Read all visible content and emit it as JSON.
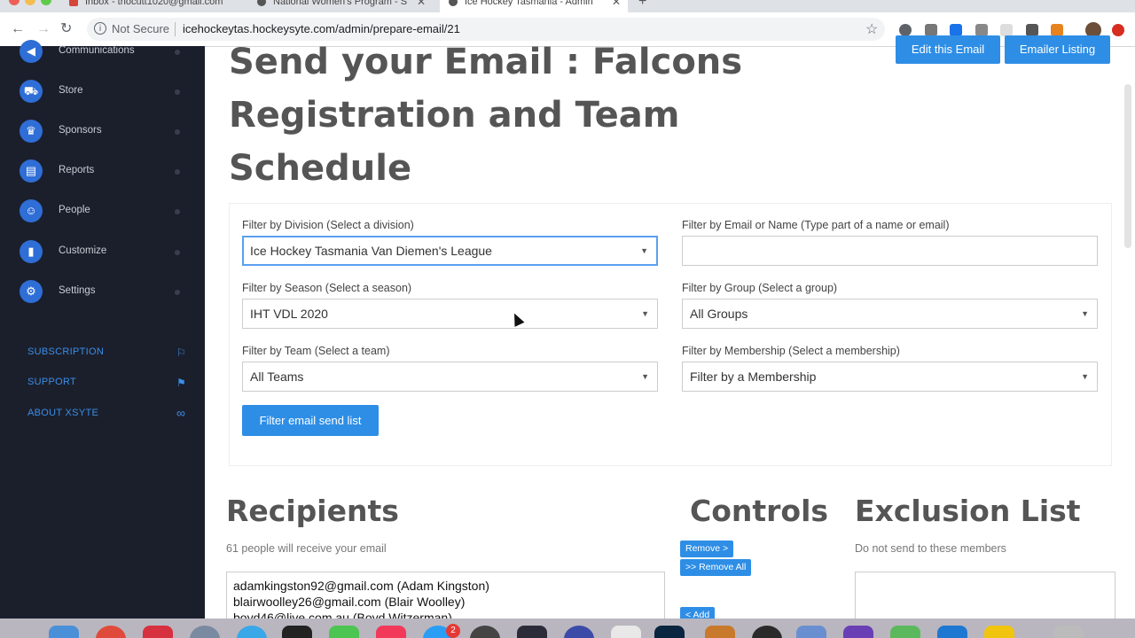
{
  "browser": {
    "tabs": [
      {
        "title": "Inbox - thocutt1020@gmail.com"
      },
      {
        "title": "National Women's Program - S"
      },
      {
        "title": "Ice Hockey Tasmania - Admin"
      }
    ],
    "security_label": "Not Secure",
    "url": "icehockeytas.hockeysyte.com/admin/prepare-email/21"
  },
  "sidebar": {
    "items": [
      {
        "label": "Communications",
        "icon": "megaphone-icon"
      },
      {
        "label": "Store",
        "icon": "cart-icon"
      },
      {
        "label": "Sponsors",
        "icon": "crown-icon"
      },
      {
        "label": "Reports",
        "icon": "document-icon"
      },
      {
        "label": "People",
        "icon": "user-icon"
      },
      {
        "label": "Customize",
        "icon": "paint-roller-icon"
      },
      {
        "label": "Settings",
        "icon": "gear-icon"
      }
    ],
    "links": [
      {
        "label": "SUBSCRIPTION"
      },
      {
        "label": "SUPPORT"
      },
      {
        "label": "ABOUT XSYTE"
      }
    ]
  },
  "main": {
    "title": "Send your Email : Falcons Registration and Team Schedule",
    "edit_button": "Edit this Email",
    "listing_button": "Emailer Listing",
    "filters": {
      "division_label": "Filter by Division (Select a division)",
      "division_value": "Ice Hockey Tasmania Van Diemen's League",
      "email_label": "Filter by Email or Name (Type part of a name or email)",
      "email_value": "",
      "season_label": "Filter by Season (Select a season)",
      "season_value": "IHT VDL 2020",
      "group_label": "Filter by Group (Select a group)",
      "group_value": "All Groups",
      "team_label": "Filter by Team (Select a team)",
      "team_value": "All Teams",
      "membership_label": "Filter by Membership (Select a membership)",
      "membership_value": "Filter by a Membership",
      "submit_label": "Filter email send list"
    },
    "recipients": {
      "heading": "Recipients",
      "summary": "61 people will receive your email",
      "list": [
        "adamkingston92@gmail.com (Adam Kingston)",
        "blairwoolley26@gmail.com (Blair Woolley)",
        "boyd46@live.com.au (Boyd Witzerman)"
      ]
    },
    "controls": {
      "heading": "Controls",
      "remove": "Remove >",
      "remove_all": ">> Remove All",
      "add": "< Add"
    },
    "exclusion": {
      "heading": "Exclusion List",
      "summary": "Do not send to these members"
    }
  },
  "dock": {
    "badge_count": "2"
  }
}
